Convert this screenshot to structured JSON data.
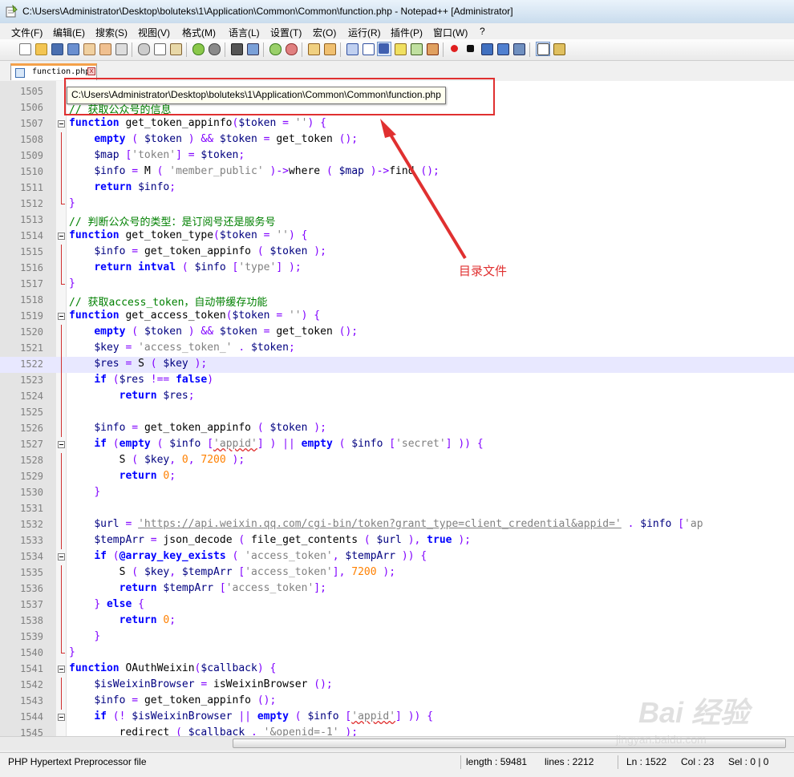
{
  "window": {
    "title": "C:\\Users\\Administrator\\Desktop\\boluteks\\1\\Application\\Common\\Common\\function.php - Notepad++ [Administrator]"
  },
  "menu": [
    "文件(F)",
    "编辑(E)",
    "搜索(S)",
    "视图(V)",
    "格式(M)",
    "语言(L)",
    "设置(T)",
    "宏(O)",
    "运行(R)",
    "插件(P)",
    "窗口(W)",
    "?"
  ],
  "tab": {
    "label": "function.php",
    "close_glyph": "x"
  },
  "tooltip": "C:\\Users\\Administrator\\Desktop\\boluteks\\1\\Application\\Common\\Common\\function.php",
  "annotation": "目录文件",
  "lines": [
    {
      "n": "1505",
      "code": ""
    },
    {
      "n": "1506",
      "code": "// 获取公众号的信息"
    },
    {
      "n": "1507",
      "code": "function get_token_appinfo($token = '') {"
    },
    {
      "n": "1508",
      "code": "    empty ( $token ) && $token = get_token ();"
    },
    {
      "n": "1509",
      "code": "    $map ['token'] = $token;"
    },
    {
      "n": "1510",
      "code": "    $info = M ( 'member_public' )->where ( $map )->find ();"
    },
    {
      "n": "1511",
      "code": "    return $info;"
    },
    {
      "n": "1512",
      "code": "}"
    },
    {
      "n": "1513",
      "code": "// 判断公众号的类型：是订阅号还是服务号"
    },
    {
      "n": "1514",
      "code": "function get_token_type($token = '') {"
    },
    {
      "n": "1515",
      "code": "    $info = get_token_appinfo ( $token );"
    },
    {
      "n": "1516",
      "code": "    return intval ( $info ['type'] );"
    },
    {
      "n": "1517",
      "code": "}"
    },
    {
      "n": "1518",
      "code": "// 获取access_token，自动带缓存功能"
    },
    {
      "n": "1519",
      "code": "function get_access_token($token = '') {"
    },
    {
      "n": "1520",
      "code": "    empty ( $token ) && $token = get_token ();"
    },
    {
      "n": "1521",
      "code": "    $key = 'access_token_' . $token;"
    },
    {
      "n": "1522",
      "code": "    $res = S ( $key );"
    },
    {
      "n": "1523",
      "code": "    if ($res !== false)"
    },
    {
      "n": "1524",
      "code": "        return $res;"
    },
    {
      "n": "1525",
      "code": ""
    },
    {
      "n": "1526",
      "code": "    $info = get_token_appinfo ( $token );"
    },
    {
      "n": "1527",
      "code": "    if (empty ( $info ['appid'] ) || empty ( $info ['secret'] )) {"
    },
    {
      "n": "1528",
      "code": "        S ( $key, 0, 7200 );"
    },
    {
      "n": "1529",
      "code": "        return 0;"
    },
    {
      "n": "1530",
      "code": "    }"
    },
    {
      "n": "1531",
      "code": ""
    },
    {
      "n": "1532",
      "code": "    $url = 'https://api.weixin.qq.com/cgi-bin/token?grant_type=client_credential&appid=' . $info ['ap"
    },
    {
      "n": "1533",
      "code": "    $tempArr = json_decode ( file_get_contents ( $url ), true );"
    },
    {
      "n": "1534",
      "code": "    if (@array_key_exists ( 'access_token', $tempArr )) {"
    },
    {
      "n": "1535",
      "code": "        S ( $key, $tempArr ['access_token'], 7200 );"
    },
    {
      "n": "1536",
      "code": "        return $tempArr ['access_token'];"
    },
    {
      "n": "1537",
      "code": "    } else {"
    },
    {
      "n": "1538",
      "code": "        return 0;"
    },
    {
      "n": "1539",
      "code": "    }"
    },
    {
      "n": "1540",
      "code": "}"
    },
    {
      "n": "1541",
      "code": "function OAuthWeixin($callback) {"
    },
    {
      "n": "1542",
      "code": "    $isWeixinBrowser = isWeixinBrowser ();"
    },
    {
      "n": "1543",
      "code": "    $info = get_token_appinfo ();"
    },
    {
      "n": "1544",
      "code": "    if (! $isWeixinBrowser || empty ( $info ['appid'] )) {"
    },
    {
      "n": "1545",
      "code": "        redirect ( $callback . '&openid=-1' );"
    }
  ],
  "status": {
    "file_type": "PHP Hypertext Preprocessor file",
    "length": "length : 59481",
    "lines": "lines : 2212",
    "ln": "Ln : 1522",
    "col": "Col : 23",
    "sel": "Sel : 0 | 0"
  },
  "watermark": {
    "brand": "Bai 经验",
    "url": "jingyan.baidu.com"
  },
  "colors": {
    "annotation": "#e03030",
    "keyword": "#0000ff",
    "comment": "#008000",
    "number": "#ff8000"
  }
}
